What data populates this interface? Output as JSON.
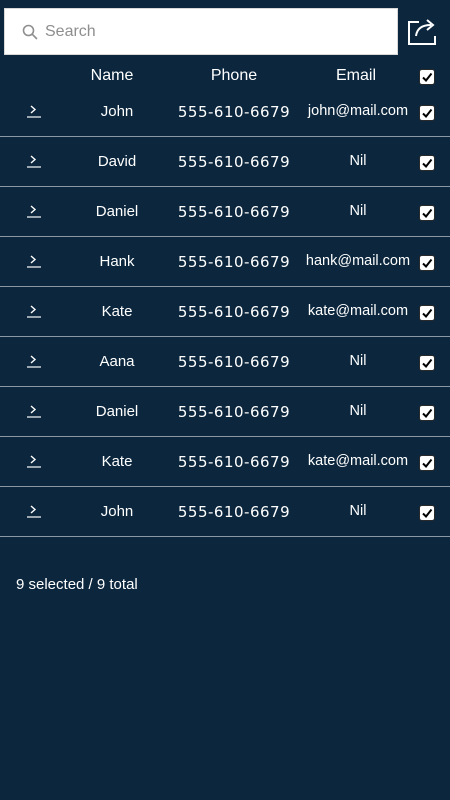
{
  "search": {
    "placeholder": "Search",
    "value": ""
  },
  "header": {
    "name_label": "Name",
    "phone_label": "Phone",
    "email_label": "Email",
    "select_all_checked": true
  },
  "rows": [
    {
      "name": "John",
      "phone": "555-610-6679",
      "email": "john@mail.com",
      "checked": true
    },
    {
      "name": "David",
      "phone": "555-610-6679",
      "email": "Nil",
      "checked": true
    },
    {
      "name": "Daniel",
      "phone": "555-610-6679",
      "email": "Nil",
      "checked": true
    },
    {
      "name": "Hank",
      "phone": "555-610-6679",
      "email": "hank@mail.com",
      "checked": true
    },
    {
      "name": "Kate",
      "phone": "555-610-6679",
      "email": "kate@mail.com",
      "checked": true
    },
    {
      "name": "Aana",
      "phone": "555-610-6679",
      "email": "Nil",
      "checked": true
    },
    {
      "name": "Daniel",
      "phone": "555-610-6679",
      "email": "Nil",
      "checked": true
    },
    {
      "name": "Kate",
      "phone": "555-610-6679",
      "email": "kate@mail.com",
      "checked": true
    },
    {
      "name": "John",
      "phone": "555-610-6679",
      "email": "Nil",
      "checked": true
    }
  ],
  "footer": {
    "status": "9 selected / 9 total"
  },
  "icons": {
    "search": "search-icon",
    "share": "share-icon",
    "chevron": "chevron-right-icon",
    "checkbox": "checkbox-checked-icon"
  },
  "colors": {
    "background": "#0b263d",
    "text": "#ffffff",
    "divider": "#8a97a4",
    "search_background": "#ffffff"
  }
}
